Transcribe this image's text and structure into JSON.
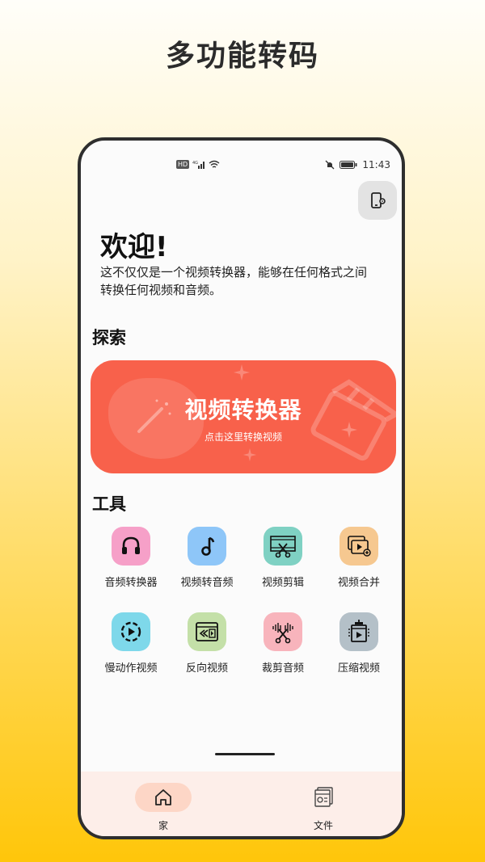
{
  "promo": {
    "title": "多功能转码"
  },
  "status_bar": {
    "hd": "HD",
    "time": "11:43"
  },
  "header": {
    "welcome_title": "欢迎!",
    "welcome_desc": "这不仅仅是一个视频转换器，能够在任何格式之间转换任何视频和音频。"
  },
  "explore": {
    "title": "探索",
    "banner_title": "视频转换器",
    "banner_subtitle": "点击这里转换视频"
  },
  "tools": {
    "title": "工具",
    "items": [
      {
        "label": "音频转换器",
        "icon": "headphones-icon",
        "color": "#f6a0c8"
      },
      {
        "label": "视频转音频",
        "icon": "music-note-icon",
        "color": "#8ec6f8"
      },
      {
        "label": "视频剪辑",
        "icon": "film-scissors-icon",
        "color": "#7fd1c3"
      },
      {
        "label": "视频合并",
        "icon": "video-merge-icon",
        "color": "#f6c890"
      },
      {
        "label": "慢动作视频",
        "icon": "slow-motion-icon",
        "color": "#7ed8ea"
      },
      {
        "label": "反向视频",
        "icon": "reverse-video-icon",
        "color": "#c4e0a8"
      },
      {
        "label": "裁剪音频",
        "icon": "audio-cut-icon",
        "color": "#f8b4bc"
      },
      {
        "label": "压缩视频",
        "icon": "compress-video-icon",
        "color": "#b4c0c8"
      }
    ]
  },
  "bottom_nav": {
    "items": [
      {
        "label": "家",
        "icon": "home-icon"
      },
      {
        "label": "文件",
        "icon": "files-icon"
      }
    ]
  },
  "colors": {
    "banner": "#f8614b",
    "nav_bg": "#fdeee9",
    "nav_active": "#fdd6c6"
  }
}
